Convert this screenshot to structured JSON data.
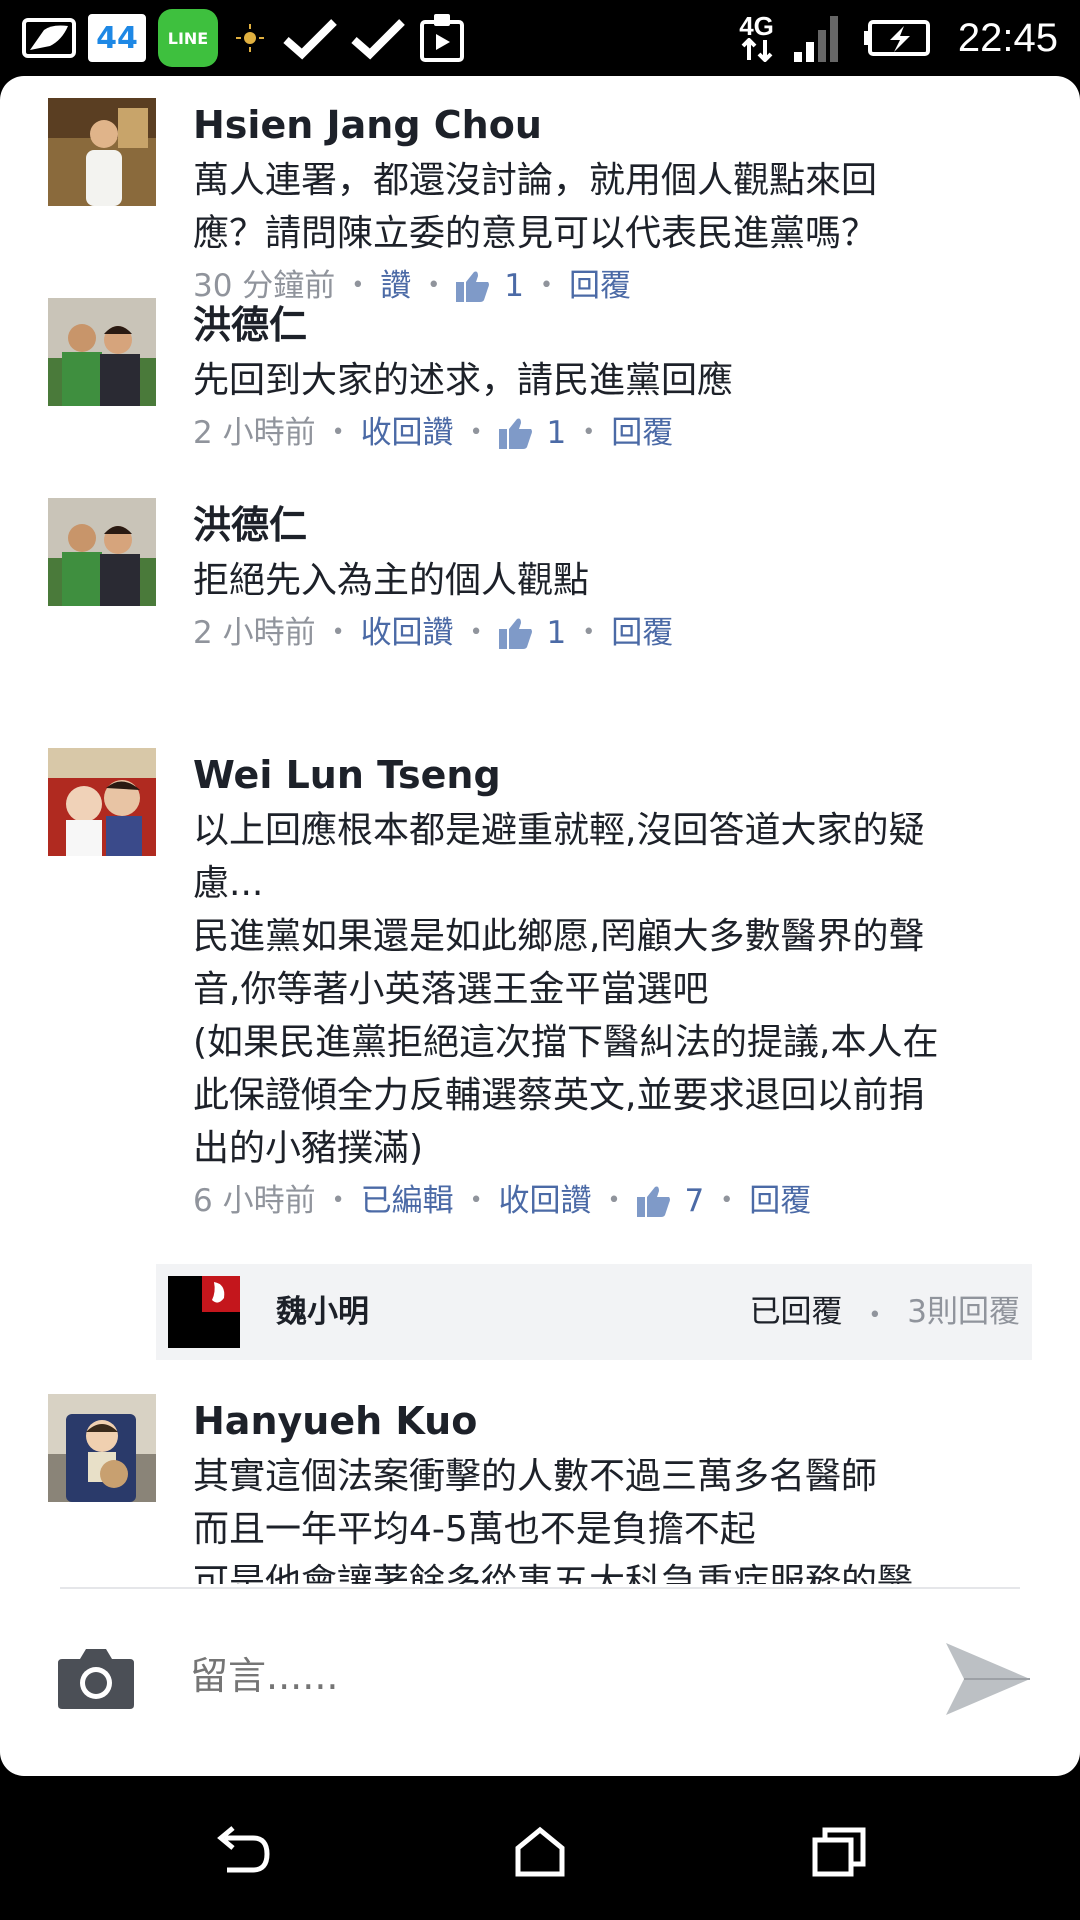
{
  "status_bar": {
    "badge_number": "44",
    "line_label": "LINE",
    "network": "4G",
    "time": "22:45"
  },
  "comments": [
    {
      "author": "Hsien Jang Chou",
      "text": "萬人連署，都還沒討論，就用個人觀點來回\n應？請問陳立委的意見可以代表民進黨嗎？",
      "time": "30 分鐘前",
      "like_action": "讚",
      "like_count": "1",
      "reply_action": "回覆"
    },
    {
      "author": "洪德仁",
      "text": "先回到大家的述求，請民進黨回應",
      "time": "2 小時前",
      "like_action": "收回讚",
      "like_count": "1",
      "reply_action": "回覆"
    },
    {
      "author": "洪德仁",
      "text": "拒絕先入為主的個人觀點",
      "time": "2 小時前",
      "like_action": "收回讚",
      "like_count": "1",
      "reply_action": "回覆"
    },
    {
      "author": "Wei Lun Tseng",
      "text": "以上回應根本都是避重就輕,沒回答道大家的疑\n慮...\n民進黨如果還是如此鄉愿,罔顧大多數醫界的聲\n音,你等著小英落選王金平當選吧\n(如果民進黨拒絕這次擋下醫糾法的提議,本人在\n此保證傾全力反輔選蔡英文,並要求退回以前捐\n出的小豬撲滿)",
      "time": "6 小時前",
      "edited": "已編輯",
      "like_action": "收回讚",
      "like_count": "7",
      "reply_action": "回覆"
    },
    {
      "author": "Hanyueh Kuo",
      "text": "其實這個法案衝擊的人數不過三萬多名醫師\n而且一年平均4-5萬也不是負擔不起\n可是他會讓著餘多從事五大科急重症服務的醫"
    }
  ],
  "reply_preview": {
    "name": "魏小明",
    "status": "已回覆",
    "reply_count": "3則回覆"
  },
  "composer": {
    "placeholder": "留言......"
  },
  "colors": {
    "link": "#4b6aa6",
    "muted": "#90949c",
    "text": "#1d2129"
  }
}
